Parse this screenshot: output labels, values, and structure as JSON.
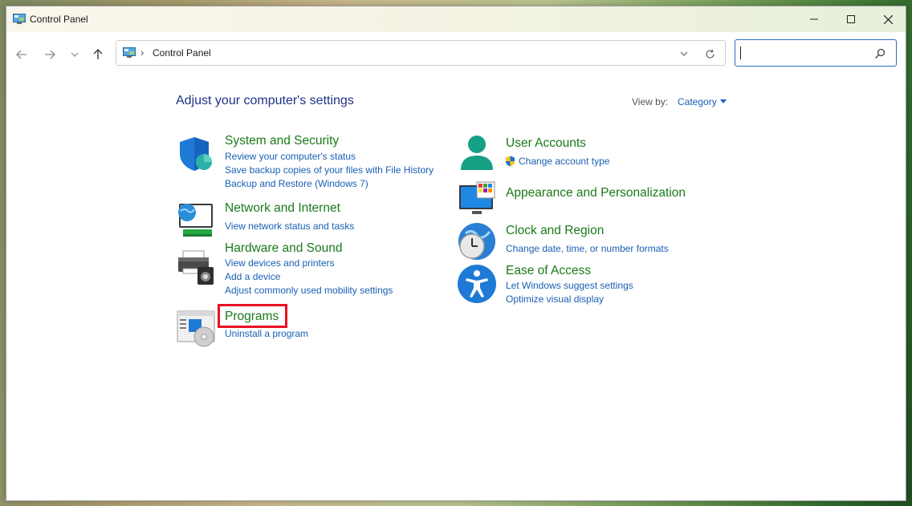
{
  "window": {
    "title": "Control Panel",
    "controls": {
      "minimize_icon": "minimize-icon",
      "maximize_icon": "maximize-icon",
      "close_icon": "close-icon"
    }
  },
  "navigation": {
    "breadcrumb_separator": "›",
    "address_text": "Control Panel",
    "search_placeholder": ""
  },
  "main": {
    "heading": "Adjust your computer's settings",
    "view_by_label": "View by:",
    "view_by_value": "Category"
  },
  "categories_left": [
    {
      "title": "System and Security",
      "icon": "shield-icon",
      "links": [
        "Review your computer's status",
        "Save backup copies of your files with File History",
        "Backup and Restore (Windows 7)"
      ]
    },
    {
      "title": "Network and Internet",
      "icon": "globe-network-icon",
      "links": [
        "View network status and tasks"
      ]
    },
    {
      "title": "Hardware and Sound",
      "icon": "printer-speaker-icon",
      "links": [
        "View devices and printers",
        "Add a device",
        "Adjust commonly used mobility settings"
      ]
    },
    {
      "title": "Programs",
      "icon": "programs-disc-icon",
      "links": [
        "Uninstall a program"
      ]
    }
  ],
  "categories_right": [
    {
      "title": "User Accounts",
      "icon": "user-icon",
      "links": [
        "Change account type"
      ]
    },
    {
      "title": "Appearance and Personalization",
      "icon": "monitor-palette-icon",
      "links": []
    },
    {
      "title": "Clock and Region",
      "icon": "clock-globe-icon",
      "links": [
        "Change date, time, or number formats"
      ]
    },
    {
      "title": "Ease of Access",
      "icon": "accessibility-icon",
      "links": [
        "Let Windows suggest settings",
        "Optimize visual display"
      ]
    }
  ],
  "colors": {
    "title_green": "#1a7a1a",
    "link_blue": "#1a5fb4",
    "heading_blue": "#1e3287",
    "highlight_red": "#e81123"
  }
}
